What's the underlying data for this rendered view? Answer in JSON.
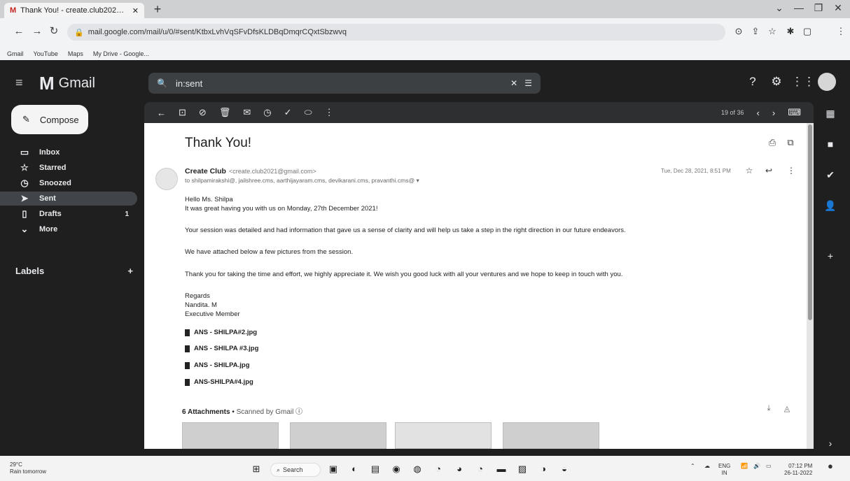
{
  "browser": {
    "tab_title": "Thank You! - create.club2021@g",
    "url": "mail.google.com/mail/u/0/#sent/KtbxLvhVqSFvDfsKLDBqDmqrCQxtSbzwvq",
    "bookmarks": [
      "Gmail",
      "YouTube",
      "Maps",
      "My Drive - Google..."
    ]
  },
  "gmail": {
    "logo_text": "Gmail",
    "search_value": "in:sent",
    "compose_label": "Compose",
    "nav": [
      {
        "label": "Inbox",
        "icon": "inbox-icon",
        "count": ""
      },
      {
        "label": "Starred",
        "icon": "star-icon",
        "count": ""
      },
      {
        "label": "Snoozed",
        "icon": "clock-icon",
        "count": ""
      },
      {
        "label": "Sent",
        "icon": "send-icon",
        "count": ""
      },
      {
        "label": "Drafts",
        "icon": "draft-icon",
        "count": "1"
      },
      {
        "label": "More",
        "icon": "chevron-down-icon",
        "count": ""
      }
    ],
    "labels_heading": "Labels",
    "pager": "19 of 36"
  },
  "message": {
    "subject": "Thank You!",
    "sender_name": "Create Club",
    "sender_addr": "<create.club2021@gmail.com>",
    "to_line": "to shilpamirakshi@, jailshree.cms, aarthijayaram.cms, devikarani.cms, pravanthi.cms@ ▾",
    "date": "Tue, Dec 28, 2021, 8:51 PM",
    "body": [
      "Hello Ms. Shilpa",
      "It was great having you with us on Monday, 27th December 2021!",
      "Your session was detailed and had information that gave us a sense of clarity and will help us take a step in the right direction in our future endeavors.",
      "We have attached below a few pictures from the session.",
      "Thank you for taking the time and effort, we highly appreciate it. We wish you good luck with all your ventures and we hope to keep in touch with you.",
      "Regards",
      "Nandita. M",
      "Executive Member"
    ],
    "attachments": [
      "ANS - SHILPA#2.jpg",
      "ANS - SHILPA #3.jpg",
      "ANS - SHILPA.jpg",
      "ANS-SHILPA#4.jpg"
    ],
    "attachments_count": "6 Attachments",
    "scanned_text": "Scanned by Gmail"
  },
  "taskbar": {
    "weather_temp": "29°C",
    "weather_desc": "Rain tomorrow",
    "search_label": "Search",
    "lang": "ENG",
    "region": "IN",
    "time": "07:12 PM",
    "date": "26-11-2022"
  }
}
